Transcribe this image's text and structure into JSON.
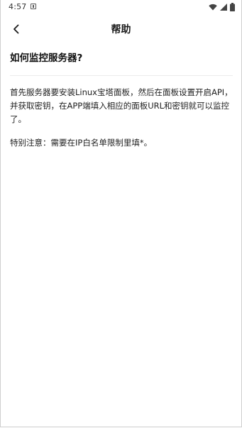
{
  "status_bar": {
    "time": "4:57",
    "notification_icon": "image-notification-icon",
    "wifi_icon": "wifi-icon",
    "signal_icon": "cell-signal-icon",
    "battery_icon": "battery-icon"
  },
  "header": {
    "back_icon": "chevron-left-icon",
    "title": "帮助"
  },
  "faq": {
    "question": "如何监控服务器?",
    "answer": "首先服务器要安装Linux宝塔面板，然后在面板设置开启API，并获取密钥，在APP端填入相应的面板URL和密钥就可以监控了。",
    "note": "特别注意：需要在IP白名单限制里填*。"
  },
  "colors": {
    "background": "#ffffff",
    "text": "#222222",
    "divider": "#ececec"
  }
}
